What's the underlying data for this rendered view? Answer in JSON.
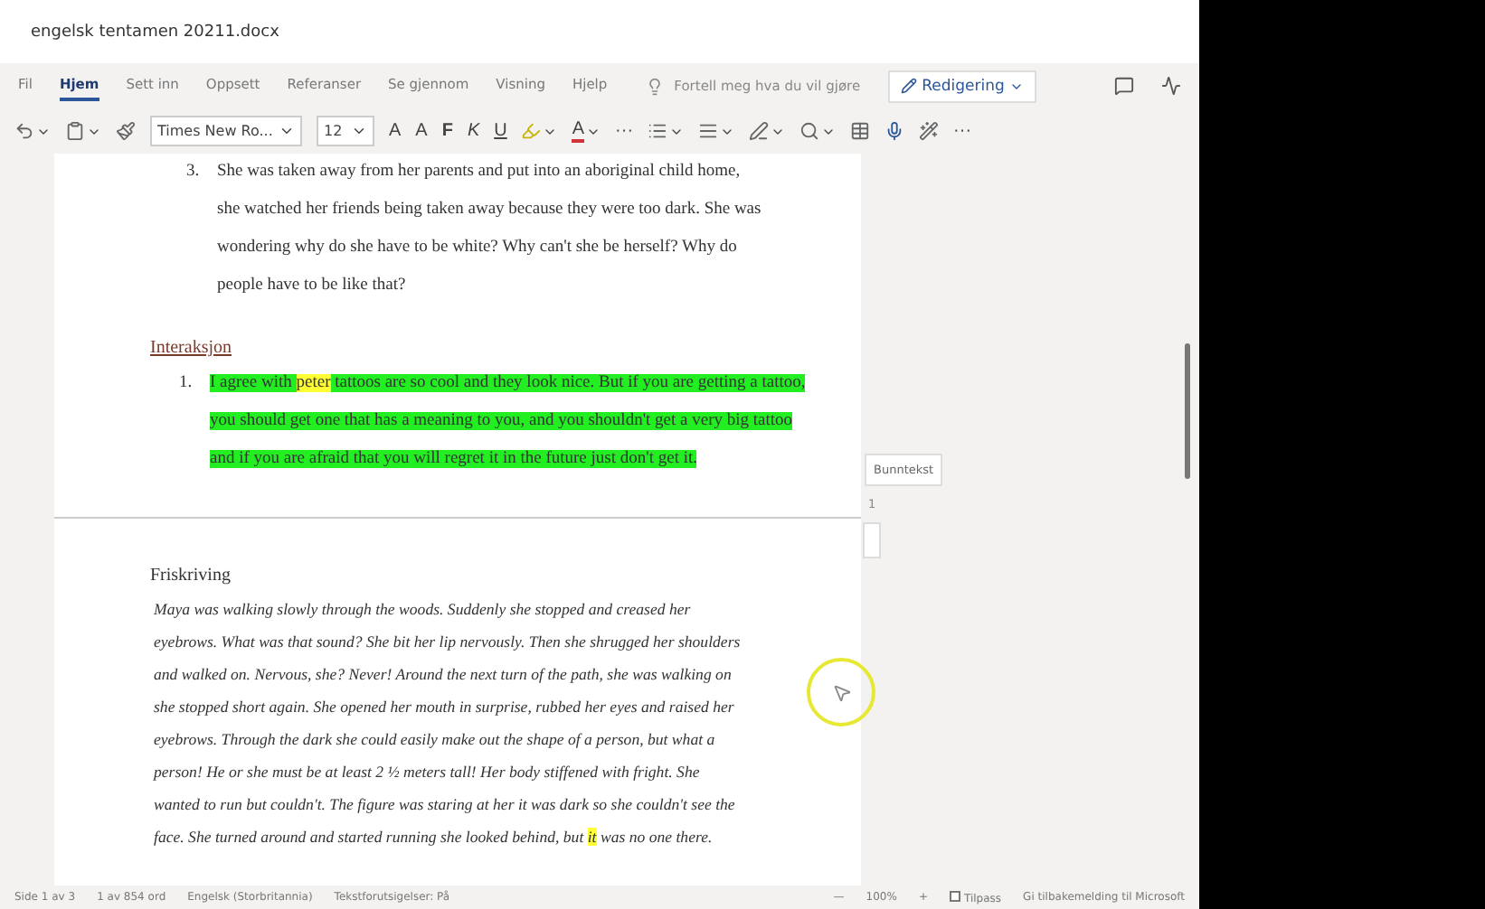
{
  "window": {
    "title": "engelsk tentamen 20211.docx"
  },
  "ribbon_tabs": [
    {
      "label": "Fil",
      "selected": false
    },
    {
      "label": "Hjem",
      "selected": true
    },
    {
      "label": "Sett inn",
      "selected": false
    },
    {
      "label": "Oppsett",
      "selected": false
    },
    {
      "label": "Referanser",
      "selected": false
    },
    {
      "label": "Se gjennom",
      "selected": false
    },
    {
      "label": "Visning",
      "selected": false
    },
    {
      "label": "Hjelp",
      "selected": false
    }
  ],
  "tell_me": {
    "placeholder": "Fortell meg hva du vil gjøre"
  },
  "mode_button": {
    "label": "Redigering"
  },
  "toolbar": [
    {
      "kind": "undo"
    },
    {
      "kind": "paste"
    },
    {
      "kind": "painter"
    },
    {
      "kind": "font",
      "value": "Times New Ro..."
    },
    {
      "kind": "size",
      "value": "12"
    },
    {
      "kind": "text",
      "label": "A"
    },
    {
      "kind": "text",
      "label": "A"
    },
    {
      "kind": "bold",
      "label": "F"
    },
    {
      "kind": "italic",
      "label": "K"
    },
    {
      "kind": "underline",
      "label": "U"
    },
    {
      "kind": "highlight"
    },
    {
      "kind": "color",
      "label": "A"
    },
    {
      "kind": "text",
      "label": "···"
    },
    {
      "kind": "bullets"
    },
    {
      "kind": "align"
    },
    {
      "kind": "styles"
    },
    {
      "kind": "find"
    },
    {
      "kind": "table"
    },
    {
      "kind": "mic"
    },
    {
      "kind": "designer"
    },
    {
      "kind": "text",
      "label": "···"
    }
  ],
  "page1": {
    "list_item": {
      "number": "3.",
      "text": "She was taken away from her parents and put into an aboriginal child home, she watched her friends being taken away because they were too dark. She was wondering why do she have to be white? Why can't she be herself? Why do people have to be like that?"
    },
    "heading": "Interaksjon",
    "answer": {
      "number": "1.",
      "segments": [
        {
          "text": "I agree with ",
          "color": "#22ee22"
        },
        {
          "text": "peter",
          "color": "#ffff33"
        },
        {
          "text": " tattoos are so cool and they look nice. But if you are getting a tattoo, you should get one that has a meaning to you, and you shouldn't get a very big tattoo and if you are afraid that you will regret it in the future just don't get it.",
          "color": "#22ee22"
        }
      ]
    }
  },
  "footer_button": {
    "label": "Bunntekst"
  },
  "page_number": "1",
  "page2": {
    "heading": "Friskriving",
    "segments": [
      {
        "text": "Maya was walking slowly through the woods. Suddenly she stopped and creased her eyebrows. What was that sound? She bit her lip nervously. Then she shrugged her shoulders and walked on. Nervous, she? Never! Around the next turn of the path, she was walking on she stopped short again. She opened her mouth in surprise, rubbed her eyes and raised her eyebrows. Through the dark she could easily make out the shape of a person, but what a person! He or she must be at least 2 ½ meters tall! Her body stiffened with fright. She wanted to run but couldn't. The figure was staring at her it was dark so she couldn't see the face. She turned around and started running she looked behind, but "
      },
      {
        "text": "it",
        "color": "#ffff33"
      },
      {
        "text": " was no one there."
      }
    ]
  },
  "status_bar": {
    "page": "Side 1 av 3",
    "words": "1 av 854 ord",
    "language": "Engelsk (Storbritannia)",
    "predictions": "Tekstforutsigelser: På",
    "zoom_out": "—",
    "zoom": "100%",
    "zoom_in": "+",
    "fit": {
      "label": "Tilpass",
      "checked": false
    },
    "feedback": "Gi tilbakemelding til Microsoft"
  }
}
